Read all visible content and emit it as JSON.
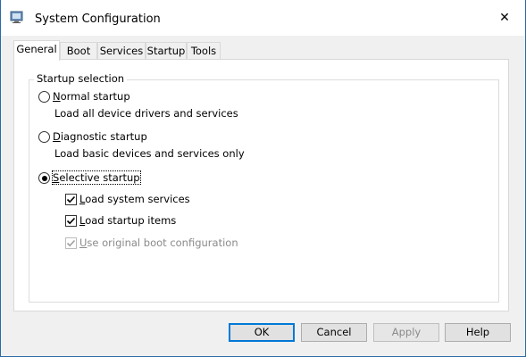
{
  "window": {
    "title": "System Configuration",
    "close_glyph": "✕",
    "app_icon": "msconfig-icon"
  },
  "tabs": [
    {
      "label": "General",
      "active": true
    },
    {
      "label": "Boot",
      "active": false
    },
    {
      "label": "Services",
      "active": false
    },
    {
      "label": "Startup",
      "active": false
    },
    {
      "label": "Tools",
      "active": false
    }
  ],
  "general": {
    "group_title": "Startup selection",
    "options": [
      {
        "mnemonic": "N",
        "label_rest": "ormal startup",
        "description": "Load all device drivers and services",
        "selected": false
      },
      {
        "mnemonic": "D",
        "label_rest": "iagnostic startup",
        "description": "Load basic devices and services only",
        "selected": false
      },
      {
        "mnemonic": "S",
        "label_rest": "elective startup",
        "selected": true
      }
    ],
    "checkboxes": [
      {
        "mnemonic": "L",
        "label_rest": "oad system services",
        "checked": true,
        "enabled": true
      },
      {
        "mnemonic": "L",
        "label_rest": "oad startup items",
        "checked": true,
        "enabled": true
      },
      {
        "mnemonic": "U",
        "label_rest": "se original boot configuration",
        "checked": true,
        "enabled": false
      }
    ]
  },
  "buttons": {
    "ok": "OK",
    "cancel": "Cancel",
    "apply": "Apply",
    "help": "Help"
  },
  "colors": {
    "accent": "#0078d7",
    "desktop": "#1b5a9a"
  }
}
